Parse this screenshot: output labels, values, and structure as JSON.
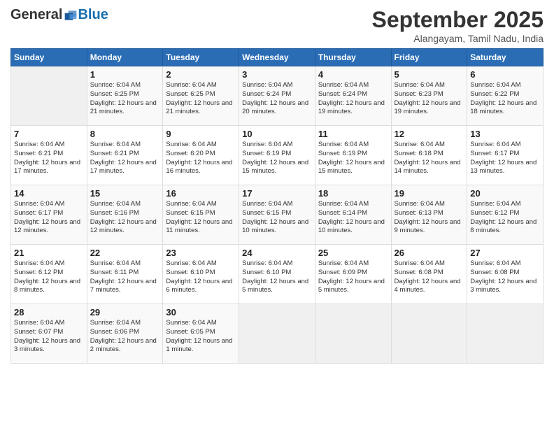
{
  "logo": {
    "general": "General",
    "blue": "Blue"
  },
  "header": {
    "month": "September 2025",
    "location": "Alangayam, Tamil Nadu, India"
  },
  "weekdays": [
    "Sunday",
    "Monday",
    "Tuesday",
    "Wednesday",
    "Thursday",
    "Friday",
    "Saturday"
  ],
  "weeks": [
    [
      {
        "day": "",
        "sunrise": "",
        "sunset": "",
        "daylight": ""
      },
      {
        "day": "1",
        "sunrise": "Sunrise: 6:04 AM",
        "sunset": "Sunset: 6:25 PM",
        "daylight": "Daylight: 12 hours and 21 minutes."
      },
      {
        "day": "2",
        "sunrise": "Sunrise: 6:04 AM",
        "sunset": "Sunset: 6:25 PM",
        "daylight": "Daylight: 12 hours and 21 minutes."
      },
      {
        "day": "3",
        "sunrise": "Sunrise: 6:04 AM",
        "sunset": "Sunset: 6:24 PM",
        "daylight": "Daylight: 12 hours and 20 minutes."
      },
      {
        "day": "4",
        "sunrise": "Sunrise: 6:04 AM",
        "sunset": "Sunset: 6:24 PM",
        "daylight": "Daylight: 12 hours and 19 minutes."
      },
      {
        "day": "5",
        "sunrise": "Sunrise: 6:04 AM",
        "sunset": "Sunset: 6:23 PM",
        "daylight": "Daylight: 12 hours and 19 minutes."
      },
      {
        "day": "6",
        "sunrise": "Sunrise: 6:04 AM",
        "sunset": "Sunset: 6:22 PM",
        "daylight": "Daylight: 12 hours and 18 minutes."
      }
    ],
    [
      {
        "day": "7",
        "sunrise": "Sunrise: 6:04 AM",
        "sunset": "Sunset: 6:21 PM",
        "daylight": "Daylight: 12 hours and 17 minutes."
      },
      {
        "day": "8",
        "sunrise": "Sunrise: 6:04 AM",
        "sunset": "Sunset: 6:21 PM",
        "daylight": "Daylight: 12 hours and 17 minutes."
      },
      {
        "day": "9",
        "sunrise": "Sunrise: 6:04 AM",
        "sunset": "Sunset: 6:20 PM",
        "daylight": "Daylight: 12 hours and 16 minutes."
      },
      {
        "day": "10",
        "sunrise": "Sunrise: 6:04 AM",
        "sunset": "Sunset: 6:19 PM",
        "daylight": "Daylight: 12 hours and 15 minutes."
      },
      {
        "day": "11",
        "sunrise": "Sunrise: 6:04 AM",
        "sunset": "Sunset: 6:19 PM",
        "daylight": "Daylight: 12 hours and 15 minutes."
      },
      {
        "day": "12",
        "sunrise": "Sunrise: 6:04 AM",
        "sunset": "Sunset: 6:18 PM",
        "daylight": "Daylight: 12 hours and 14 minutes."
      },
      {
        "day": "13",
        "sunrise": "Sunrise: 6:04 AM",
        "sunset": "Sunset: 6:17 PM",
        "daylight": "Daylight: 12 hours and 13 minutes."
      }
    ],
    [
      {
        "day": "14",
        "sunrise": "Sunrise: 6:04 AM",
        "sunset": "Sunset: 6:17 PM",
        "daylight": "Daylight: 12 hours and 12 minutes."
      },
      {
        "day": "15",
        "sunrise": "Sunrise: 6:04 AM",
        "sunset": "Sunset: 6:16 PM",
        "daylight": "Daylight: 12 hours and 12 minutes."
      },
      {
        "day": "16",
        "sunrise": "Sunrise: 6:04 AM",
        "sunset": "Sunset: 6:15 PM",
        "daylight": "Daylight: 12 hours and 11 minutes."
      },
      {
        "day": "17",
        "sunrise": "Sunrise: 6:04 AM",
        "sunset": "Sunset: 6:15 PM",
        "daylight": "Daylight: 12 hours and 10 minutes."
      },
      {
        "day": "18",
        "sunrise": "Sunrise: 6:04 AM",
        "sunset": "Sunset: 6:14 PM",
        "daylight": "Daylight: 12 hours and 10 minutes."
      },
      {
        "day": "19",
        "sunrise": "Sunrise: 6:04 AM",
        "sunset": "Sunset: 6:13 PM",
        "daylight": "Daylight: 12 hours and 9 minutes."
      },
      {
        "day": "20",
        "sunrise": "Sunrise: 6:04 AM",
        "sunset": "Sunset: 6:12 PM",
        "daylight": "Daylight: 12 hours and 8 minutes."
      }
    ],
    [
      {
        "day": "21",
        "sunrise": "Sunrise: 6:04 AM",
        "sunset": "Sunset: 6:12 PM",
        "daylight": "Daylight: 12 hours and 8 minutes."
      },
      {
        "day": "22",
        "sunrise": "Sunrise: 6:04 AM",
        "sunset": "Sunset: 6:11 PM",
        "daylight": "Daylight: 12 hours and 7 minutes."
      },
      {
        "day": "23",
        "sunrise": "Sunrise: 6:04 AM",
        "sunset": "Sunset: 6:10 PM",
        "daylight": "Daylight: 12 hours and 6 minutes."
      },
      {
        "day": "24",
        "sunrise": "Sunrise: 6:04 AM",
        "sunset": "Sunset: 6:10 PM",
        "daylight": "Daylight: 12 hours and 5 minutes."
      },
      {
        "day": "25",
        "sunrise": "Sunrise: 6:04 AM",
        "sunset": "Sunset: 6:09 PM",
        "daylight": "Daylight: 12 hours and 5 minutes."
      },
      {
        "day": "26",
        "sunrise": "Sunrise: 6:04 AM",
        "sunset": "Sunset: 6:08 PM",
        "daylight": "Daylight: 12 hours and 4 minutes."
      },
      {
        "day": "27",
        "sunrise": "Sunrise: 6:04 AM",
        "sunset": "Sunset: 6:08 PM",
        "daylight": "Daylight: 12 hours and 3 minutes."
      }
    ],
    [
      {
        "day": "28",
        "sunrise": "Sunrise: 6:04 AM",
        "sunset": "Sunset: 6:07 PM",
        "daylight": "Daylight: 12 hours and 3 minutes."
      },
      {
        "day": "29",
        "sunrise": "Sunrise: 6:04 AM",
        "sunset": "Sunset: 6:06 PM",
        "daylight": "Daylight: 12 hours and 2 minutes."
      },
      {
        "day": "30",
        "sunrise": "Sunrise: 6:04 AM",
        "sunset": "Sunset: 6:05 PM",
        "daylight": "Daylight: 12 hours and 1 minute."
      },
      {
        "day": "",
        "sunrise": "",
        "sunset": "",
        "daylight": ""
      },
      {
        "day": "",
        "sunrise": "",
        "sunset": "",
        "daylight": ""
      },
      {
        "day": "",
        "sunrise": "",
        "sunset": "",
        "daylight": ""
      },
      {
        "day": "",
        "sunrise": "",
        "sunset": "",
        "daylight": ""
      }
    ]
  ]
}
